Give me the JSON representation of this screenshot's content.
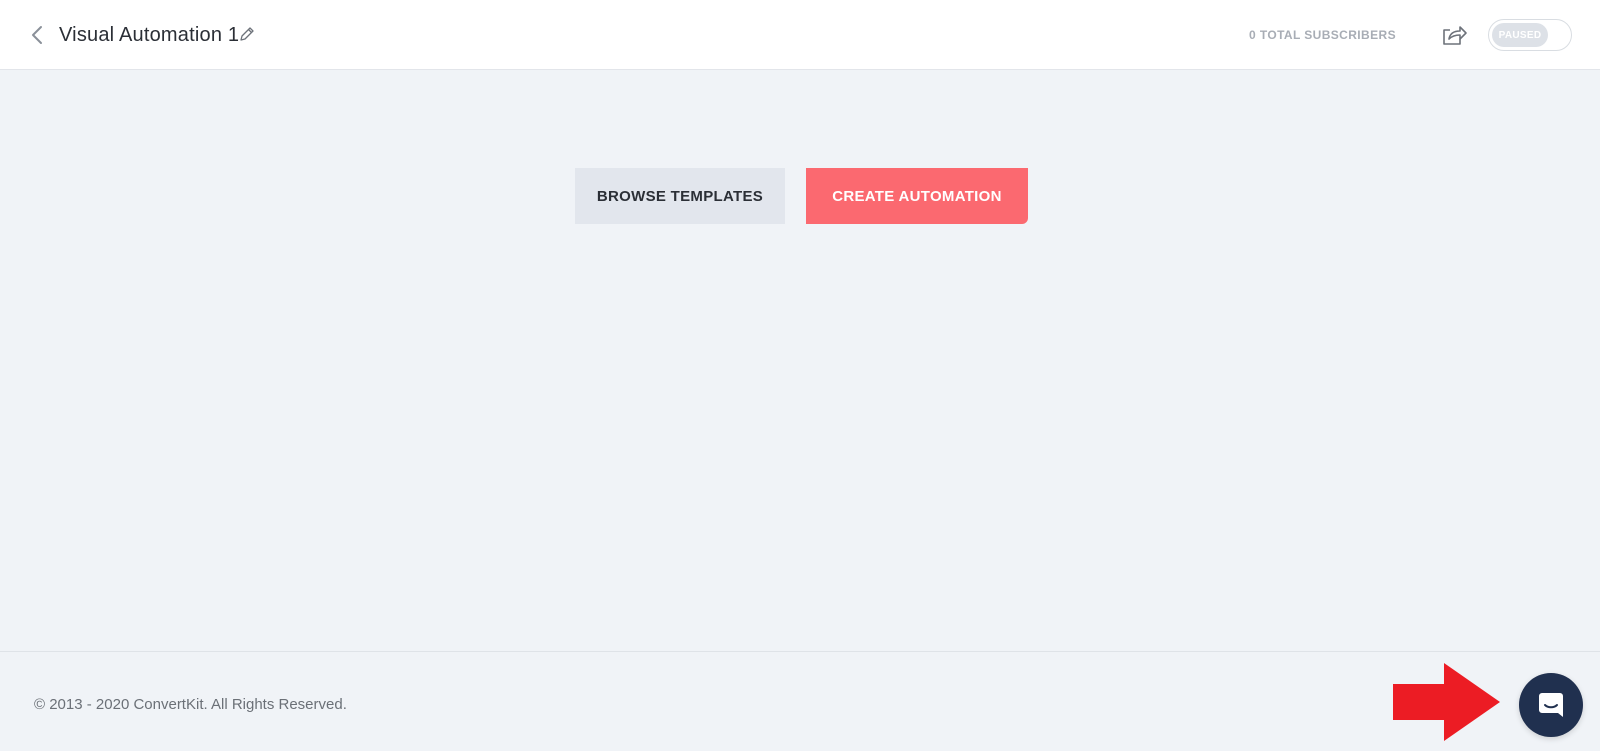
{
  "header": {
    "back_icon": "chevron-left-icon",
    "title": "Visual Automation 1",
    "edit_icon": "pencil-icon",
    "subscriber_count": "0 TOTAL SUBSCRIBERS",
    "share_icon": "share-icon",
    "status_label": "PAUSED"
  },
  "main": {
    "browse_label": "BROWSE TEMPLATES",
    "create_label": "CREATE AUTOMATION"
  },
  "footer": {
    "copyright": "© 2013 - 2020 ConvertKit. All Rights Reserved."
  },
  "chat": {
    "icon": "chat-bubble-icon"
  },
  "colors": {
    "accent": "#fb6970",
    "chat_launcher": "#20304f",
    "annotation_arrow": "#ec1c24",
    "page_bg": "#f0f3f7"
  }
}
